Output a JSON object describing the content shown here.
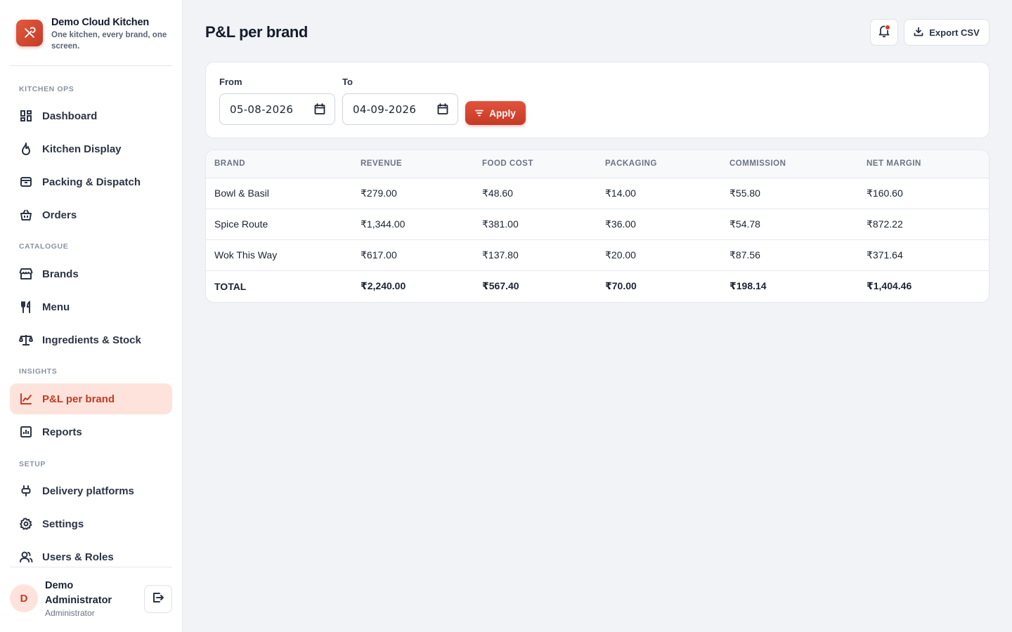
{
  "sidebar": {
    "brand_name": "Demo Cloud Kitchen",
    "tagline": "One kitchen, every brand, one screen.",
    "sections": {
      "kitchen_ops": "KITCHEN OPS",
      "catalogue": "CATALOGUE",
      "insights": "INSIGHTS",
      "setup": "SETUP"
    },
    "items": {
      "dashboard": "Dashboard",
      "kitchen_display": "Kitchen Display",
      "packing_dispatch": "Packing & Dispatch",
      "orders": "Orders",
      "brands": "Brands",
      "menu": "Menu",
      "ingredients_stock": "Ingredients & Stock",
      "pl_per_brand": "P&L per brand",
      "reports": "Reports",
      "delivery_platforms": "Delivery platforms",
      "settings": "Settings",
      "users_roles": "Users & Roles"
    },
    "active_item": "P&L per brand",
    "user": {
      "initial": "D",
      "name": "Demo Administrator",
      "role": "Administrator"
    }
  },
  "header": {
    "title": "P&L per brand",
    "export_label": "Export CSV",
    "notification_badge": true
  },
  "filters": {
    "from_label": "From",
    "from_value": "05-08-2026",
    "to_label": "To",
    "to_value": "04-09-2026",
    "apply_label": "Apply"
  },
  "table": {
    "columns": [
      "BRAND",
      "REVENUE",
      "FOOD COST",
      "PACKAGING",
      "COMMISSION",
      "NET MARGIN"
    ],
    "rows": [
      [
        "Bowl & Basil",
        "₹279.00",
        "₹48.60",
        "₹14.00",
        "₹55.80",
        "₹160.60"
      ],
      [
        "Spice Route",
        "₹1,344.00",
        "₹381.00",
        "₹36.00",
        "₹54.78",
        "₹872.22"
      ],
      [
        "Wok This Way",
        "₹617.00",
        "₹137.80",
        "₹20.00",
        "₹87.56",
        "₹371.64"
      ]
    ],
    "total": [
      "TOTAL",
      "₹2,240.00",
      "₹567.40",
      "₹70.00",
      "₹198.14",
      "₹1,404.46"
    ]
  },
  "colors": {
    "accent": "#c53a26",
    "accent_light": "#fde3dc",
    "background": "#f1f3f7"
  }
}
